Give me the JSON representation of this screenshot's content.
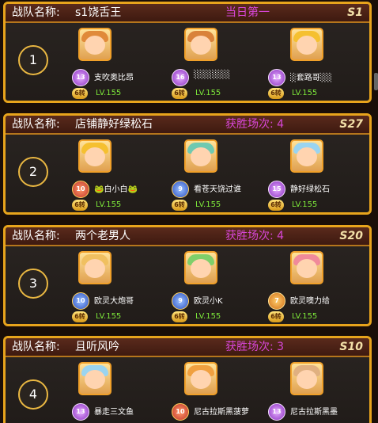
{
  "labels": {
    "team_label": "战队名称:",
    "lv_prefix": "LV.",
    "coin": "6转"
  },
  "teams": [
    {
      "rank": "1",
      "name": "s1饶舌王",
      "status": "当日第一",
      "season": "S1",
      "members": [
        {
          "badge": "13",
          "badge_color": "purple",
          "name": "支吹奥比昂",
          "level": "LV.155",
          "hair": "#e08a3a"
        },
        {
          "badge": "16",
          "badge_color": "purple",
          "name": "░░░░░░",
          "level": "LV.155",
          "hair": "#d9823a"
        },
        {
          "badge": "13",
          "badge_color": "purple",
          "name": "░套路哥░░",
          "level": "LV.155",
          "hair": "#f5c030"
        }
      ]
    },
    {
      "rank": "2",
      "name": "店铺静好绿松石",
      "status": "获胜场次: 4",
      "season": "S27",
      "members": [
        {
          "badge": "10",
          "badge_color": "red",
          "name": "🐸白小白🐸",
          "level": "LV.155",
          "hair": "#f5c030"
        },
        {
          "badge": "9",
          "badge_color": "blue",
          "name": "看苍天饶过谁",
          "level": "LV.155",
          "hair": "#6fc9b0"
        },
        {
          "badge": "15",
          "badge_color": "purple",
          "name": "静好绿松石",
          "level": "LV.155",
          "hair": "#9ad4f0"
        }
      ]
    },
    {
      "rank": "3",
      "name": "两个老男人",
      "status": "获胜场次: 4",
      "season": "S20",
      "members": [
        {
          "badge": "10",
          "badge_color": "blue",
          "name": "欧灵大炮哥",
          "level": "LV.155",
          "hair": "#f0c060"
        },
        {
          "badge": "9",
          "badge_color": "blue",
          "name": "欧灵小K",
          "level": "LV.155",
          "hair": "#7fcf6a"
        },
        {
          "badge": "7",
          "badge_color": "orange",
          "name": "欧灵噢力给",
          "level": "LV.155",
          "hair": "#f08a9a"
        }
      ]
    },
    {
      "rank": "4",
      "name": "且听风吟",
      "status": "获胜场次: 3",
      "season": "S10",
      "members": [
        {
          "badge": "13",
          "badge_color": "purple",
          "name": "暴走三文鱼",
          "level": "",
          "hair": "#9ad4f0"
        },
        {
          "badge": "10",
          "badge_color": "red",
          "name": "尼古拉斯黑菠萝",
          "level": "",
          "hair": "#f0a040"
        },
        {
          "badge": "13",
          "badge_color": "purple",
          "name": "尼古拉斯黑墨",
          "level": "",
          "hair": "#e0b080"
        }
      ]
    }
  ]
}
